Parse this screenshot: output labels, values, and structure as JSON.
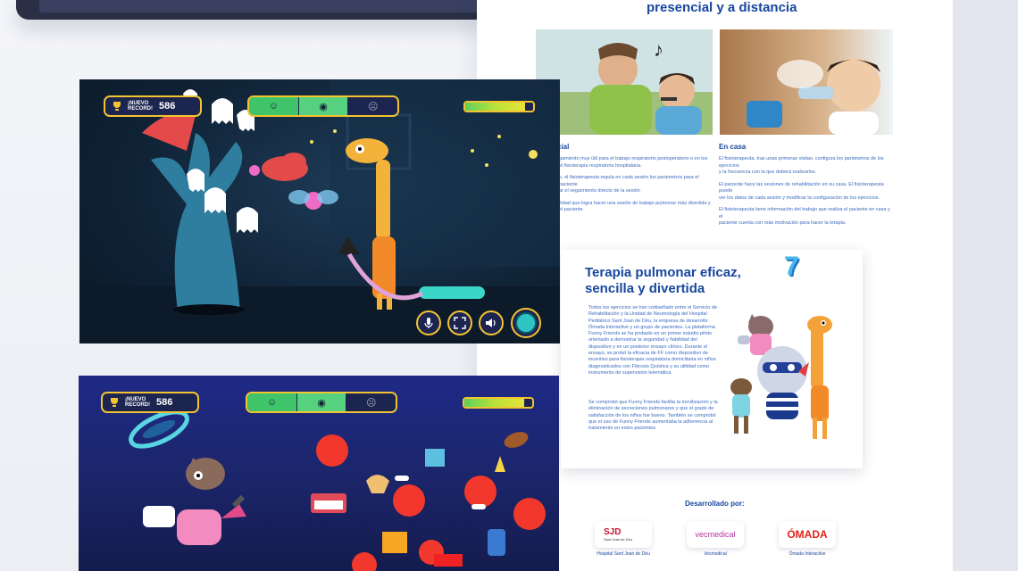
{
  "section": {
    "heading": "presencial y a distancia"
  },
  "columns": {
    "left": {
      "title": "cial",
      "paragraphs": [
        "gamiento muy útil para el trabajo respiratorio postoperatorio o en los",
        "el fisioterapia respiratoria hospitalaria.",
        "o, el fisioterapeuta regula en cada sesión los parámetros para el paciente",
        "ar el seguimiento directo de la sesión",
        "ilidad que logra hacer una sesión de trabajo pulmonar más divertida y",
        "el paciente"
      ]
    },
    "right": {
      "title": "En casa",
      "paragraphs": [
        "El fisioterapeuta, tras unas primeras visitas, configura los parámetros de los ejercicios",
        "y la frecuencia con la que deberá realizarlos.",
        "El paciente hace las sesiones de rehabilitación en su casa. El fisioterapeuta puede",
        "ver los datos de cada sesión y modificar la configuración de los ejercicios.",
        "El fisioterapeuta tiene información del trabajo que realiza el paciente en casa y el",
        "paciente cuenta con más motivación para hacer la terapia."
      ]
    }
  },
  "card": {
    "title": "Terapia pulmonar eficaz, sencilla y divertida",
    "badge": "7",
    "paragraph1": "Todos los ejercicios se han codiseñado entre el Servicio de Rehabilitación y la Unidad de Neumología del Hospital Pediátrico Sant Joan de Déu, la empresa de desarrollo Ómada Interactive y un grupo de pacientes. La plataforma Funny Friends se ha probado en un primer estudio piloto orientado a demostrar la seguridad y fiabilidad del dispositivo y en un posterior ensayo clínico. Durante el ensayo, se probó la eficacia de FF como dispositivo de incentivo para fisioterapia respiratoria domiciliaria en niños diagnosticados con Fibrosis Quística y su utilidad como instrumento de supervisión telemática.",
    "paragraph2": "Se comprobó que Funny Friends facilita la movilización y la eliminación de secreciones pulmonares y que el grado de satisfacción de los niños fue bueno. También se comprobó que el uso de Funny Friends aumentaba la adherencia al tratamiento en estos pacientes."
  },
  "developed": {
    "label": "Desarrollado por:",
    "partners": [
      {
        "logo": "SJD",
        "logo_sub": "Sant Joan de Déu",
        "caption": "Hospital Sant Joan de Déu"
      },
      {
        "logo": "vecmedical",
        "caption": "Vecmedical"
      },
      {
        "logo": "ÓMADA",
        "caption": "Ómada Interactive"
      }
    ]
  },
  "game": {
    "record_label_line1": "¡NUEVO",
    "record_label_line2": "RECORD!",
    "score": "586",
    "energy_level": 0.88,
    "controls": [
      "microphone-icon",
      "fullscreen-icon",
      "volume-icon",
      "progress-ring-icon"
    ]
  },
  "colors": {
    "accent": "#17479e",
    "text_blue": "#3b6bbf",
    "hud_gold": "#f4c430",
    "hud_bg": "#1c2450"
  }
}
